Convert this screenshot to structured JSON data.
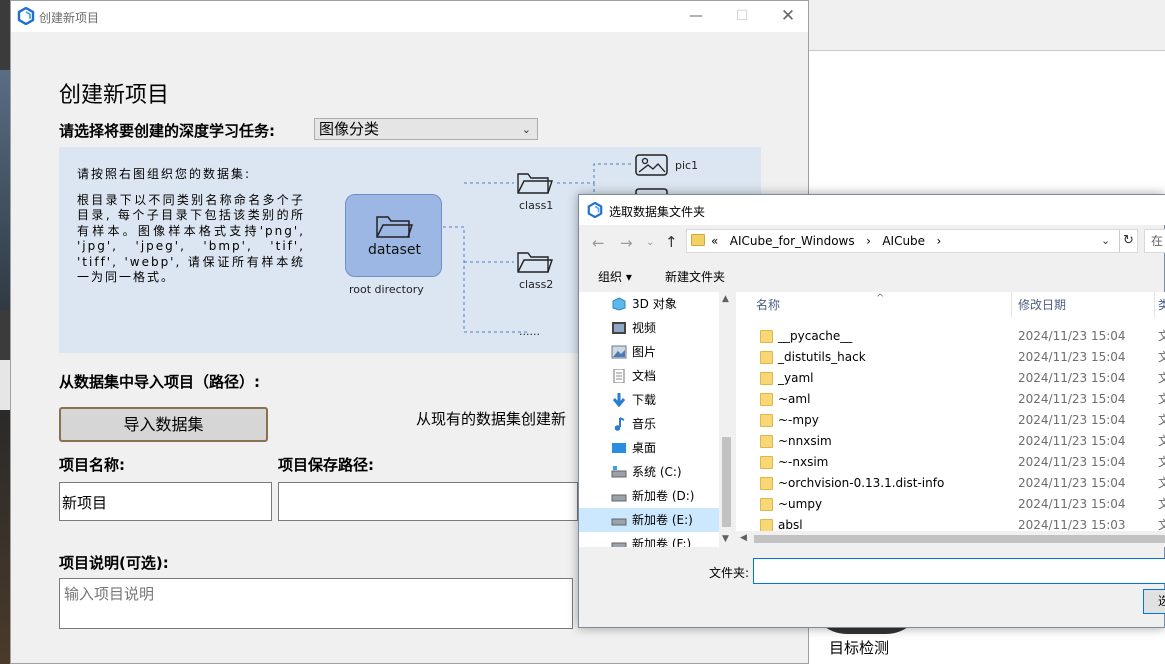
{
  "main_window": {
    "title": "创建新项目",
    "heading": "创建新项目",
    "task_label": "请选择将要创建的深度学习任务:",
    "task_selected": "图像分类",
    "info_paragraph_1": "请按照右图组织您的数据集:",
    "info_paragraph_2": "根目录下以不同类别名称命名多个子目录, 每个子目录下包括该类别的所有样本。图像样本格式支持'png', 'jpg', 'jpeg', 'bmp', 'tif', 'tiff', 'webp', 请保证所有样本统一为同一格式。",
    "diagram": {
      "dataset_label": "dataset",
      "root_label": "root directory",
      "class1": "class1",
      "class2": "class2",
      "pic1": "pic1",
      "ellipsis": "......"
    },
    "import_heading": "从数据集中导入项目（路径）:",
    "import_button": "导入数据集",
    "import_hint": "从现有的数据集创建新",
    "name_label": "项目名称:",
    "name_value": "新项目",
    "path_label": "项目保存路径:",
    "desc_label": "项目说明(可选):",
    "desc_placeholder": "输入项目说明"
  },
  "background": {
    "bottom_label": "目标检测"
  },
  "dialog": {
    "title": "选取数据集文件夹",
    "address": {
      "prefix": "«",
      "crumb_1": "AICube_for_Windows",
      "separator_1": "›",
      "crumb_2": "AICube",
      "separator_2": "›"
    },
    "search_stub": "在",
    "toolbar": {
      "organize": "组织 ▾",
      "new_folder": "新建文件夹"
    },
    "nav_items": [
      {
        "label": "3D 对象",
        "icon": "3d-objects-icon"
      },
      {
        "label": "视频",
        "icon": "video-icon"
      },
      {
        "label": "图片",
        "icon": "pictures-icon"
      },
      {
        "label": "文档",
        "icon": "documents-icon"
      },
      {
        "label": "下载",
        "icon": "download-icon"
      },
      {
        "label": "音乐",
        "icon": "music-icon"
      },
      {
        "label": "桌面",
        "icon": "desktop-icon"
      },
      {
        "label": "系统 (C:)",
        "icon": "drive-icon"
      },
      {
        "label": "新加卷 (D:)",
        "icon": "drive-icon"
      },
      {
        "label": "新加卷 (E:)",
        "icon": "drive-icon"
      },
      {
        "label": "新加卷 (F:)",
        "icon": "drive-icon"
      }
    ],
    "columns": {
      "name": "名称",
      "date": "修改日期",
      "type": "类"
    },
    "files": [
      {
        "name": "__pycache__",
        "date": "2024/11/23 15:04",
        "type": "文"
      },
      {
        "name": "_distutils_hack",
        "date": "2024/11/23 15:04",
        "type": "文"
      },
      {
        "name": "_yaml",
        "date": "2024/11/23 15:04",
        "type": "文"
      },
      {
        "name": "~aml",
        "date": "2024/11/23 15:04",
        "type": "文"
      },
      {
        "name": "~-mpy",
        "date": "2024/11/23 15:04",
        "type": "文"
      },
      {
        "name": "~nnxsim",
        "date": "2024/11/23 15:04",
        "type": "文"
      },
      {
        "name": "~-nxsim",
        "date": "2024/11/23 15:04",
        "type": "文"
      },
      {
        "name": "~orchvision-0.13.1.dist-info",
        "date": "2024/11/23 15:04",
        "type": "文"
      },
      {
        "name": "~umpy",
        "date": "2024/11/23 15:04",
        "type": "文"
      },
      {
        "name": "absl",
        "date": "2024/11/23 15:03",
        "type": "文"
      }
    ],
    "folder_label": "文件夹:",
    "folder_value": "",
    "ok_stub": "选"
  }
}
